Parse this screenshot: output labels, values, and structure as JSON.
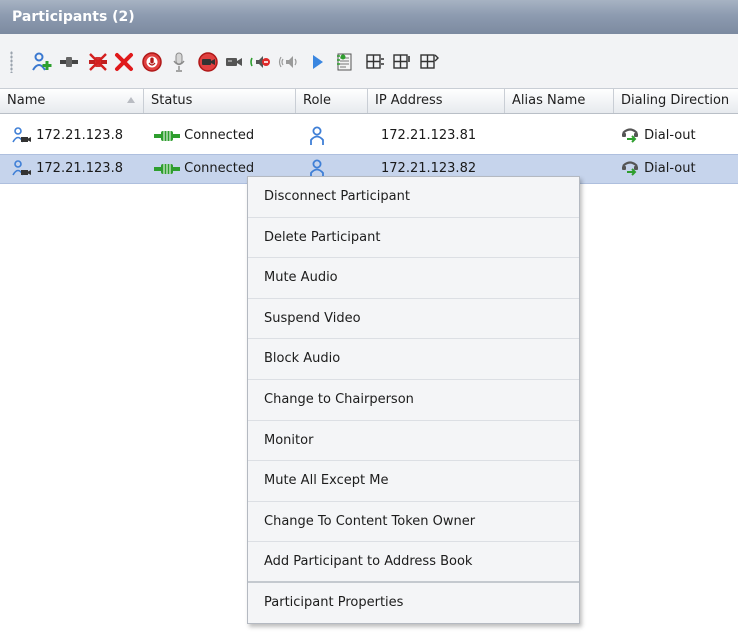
{
  "panel": {
    "title": "Participants (2)"
  },
  "toolbar": {
    "icons": [
      "add-participant-icon",
      "connect-icon",
      "disconnect-icon",
      "delete-icon",
      "mute-audio-icon",
      "microphone-icon",
      "suspend-video-icon",
      "video-camera-icon",
      "speaker-left-icon",
      "speaker-volume-icon",
      "play-icon",
      "address-book-icon",
      "layout-icon",
      "layout-personal-icon",
      "layout-export-icon"
    ]
  },
  "table": {
    "columns": [
      "Name",
      "Status",
      "Role",
      "IP Address",
      "Alias Name",
      "Dialing Direction"
    ],
    "rows": [
      {
        "name": "172.21.123.8",
        "status": "Connected",
        "ip": "172.21.123.81",
        "alias": "",
        "direction": "Dial-out",
        "selected": false
      },
      {
        "name": "172.21.123.8",
        "status": "Connected",
        "ip": "172.21.123.82",
        "alias": "",
        "direction": "Dial-out",
        "selected": true
      }
    ]
  },
  "context_menu": {
    "items": [
      "Disconnect Participant",
      "Delete Participant",
      "Mute Audio",
      "Suspend Video",
      "Block Audio",
      "Change to Chairperson",
      "Monitor",
      "Mute All Except Me",
      "Change To Content Token Owner",
      "Add Participant to Address Book",
      "Participant Properties"
    ]
  },
  "colors": {
    "title_bar": "#8d9bb0",
    "selected_row": "#c6d4ec",
    "connected_green": "#2e9e2e",
    "role_blue": "#3f7fd6"
  }
}
